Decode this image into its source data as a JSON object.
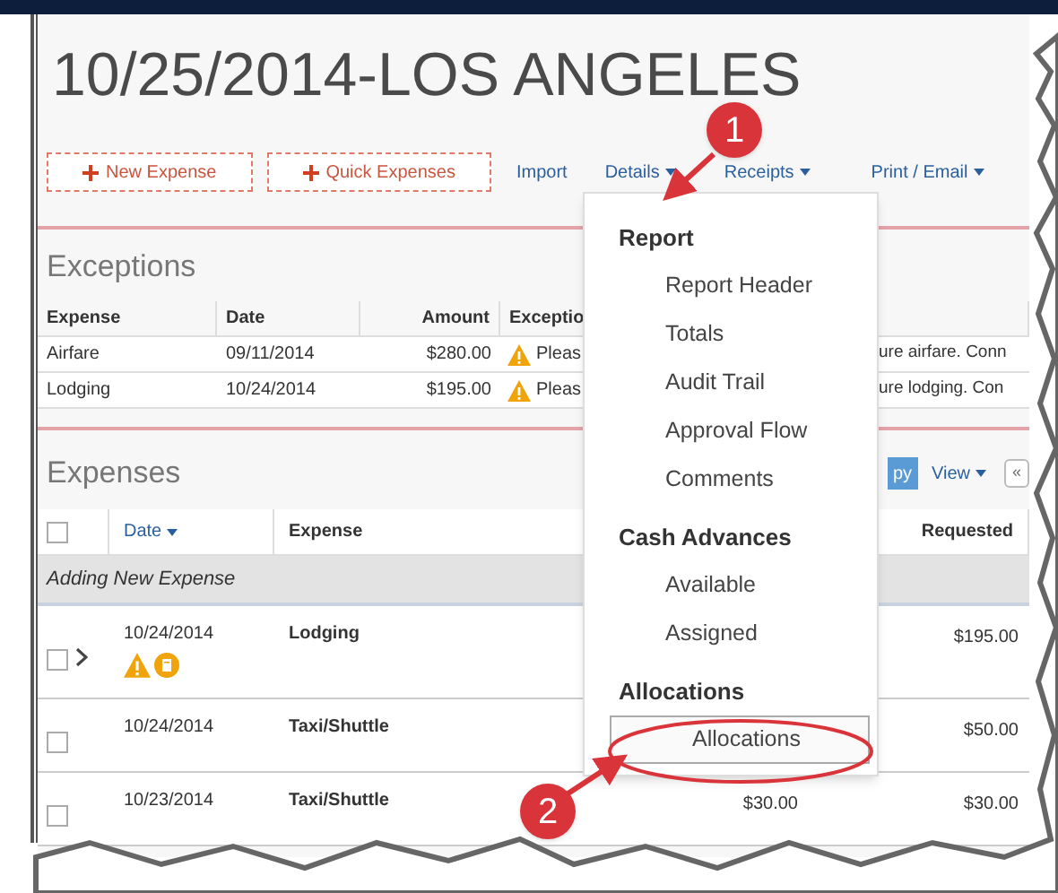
{
  "title": "10/25/2014-LOS ANGELES",
  "toolbar": [
    {
      "label": "New Expense",
      "kind": "add"
    },
    {
      "label": "Quick Expenses",
      "kind": "add"
    },
    {
      "label": "Import",
      "kind": "link"
    },
    {
      "label": "Details",
      "kind": "menu"
    },
    {
      "label": "Receipts",
      "kind": "menu"
    },
    {
      "label": "Print / Email",
      "kind": "menu"
    }
  ],
  "exceptions": {
    "heading": "Exceptions",
    "columns": [
      "Expense",
      "Date",
      "Amount",
      "Exceptio"
    ],
    "rows": [
      {
        "expense": "Airfare",
        "date": "09/11/2014",
        "amount": "$280.00",
        "exception": "Pleas",
        "exception_tail": "ure airfare. Conn"
      },
      {
        "expense": "Lodging",
        "date": "10/24/2014",
        "amount": "$195.00",
        "exception": "Pleas",
        "exception_tail": "ure lodging. Con"
      }
    ]
  },
  "expenses": {
    "heading": "Expenses",
    "apply_button": "py",
    "view_menu": "View",
    "collapse_button": "«",
    "select_all_checked": false,
    "columns": [
      {
        "label": "Date",
        "sortable": true
      },
      {
        "label": "Expense",
        "sortable": false
      },
      {
        "label": "Requested",
        "sortable": false
      }
    ],
    "group": "Adding New Expense",
    "rows": [
      {
        "date": "10/24/2014",
        "expense": "Lodging",
        "requested": "$195.00",
        "expandable": true,
        "alerts": true,
        "checked": false
      },
      {
        "date": "10/24/2014",
        "expense": "Taxi/Shuttle",
        "requested": "$50.00",
        "expandable": false,
        "alerts": false,
        "checked": false
      },
      {
        "date": "10/23/2014",
        "expense": "Taxi/Shuttle",
        "amount": "$30.00",
        "requested": "$30.00",
        "expandable": false,
        "alerts": false,
        "checked": false
      }
    ]
  },
  "details_menu": [
    {
      "heading": "Report",
      "items": [
        {
          "label": "Report Header",
          "selected": false
        },
        {
          "label": "Totals",
          "selected": false
        },
        {
          "label": "Audit Trail",
          "selected": false
        },
        {
          "label": "Approval Flow",
          "selected": false
        },
        {
          "label": "Comments",
          "selected": false
        }
      ]
    },
    {
      "heading": "Cash Advances",
      "items": [
        {
          "label": "Available",
          "selected": false
        },
        {
          "label": "Assigned",
          "selected": false
        }
      ]
    },
    {
      "heading": "Allocations",
      "items": [
        {
          "label": "Allocations",
          "selected": true
        }
      ]
    }
  ],
  "callouts": [
    "1",
    "2"
  ]
}
